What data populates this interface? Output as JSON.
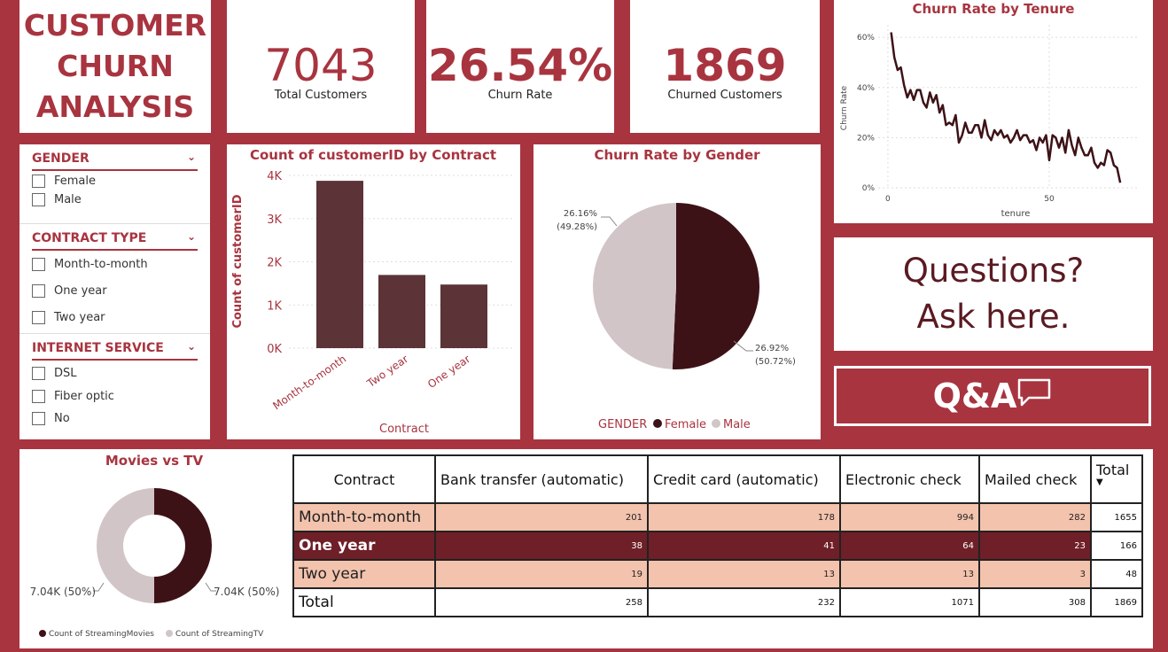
{
  "header": {
    "line1": "CUSTOMER",
    "line2": "CHURN",
    "line3": "ANALYSIS"
  },
  "kpis": [
    {
      "value": "7043",
      "label": "Total Customers"
    },
    {
      "value": "26.54%",
      "label": "Churn Rate"
    },
    {
      "value": "1869",
      "label": "Churned Customers"
    }
  ],
  "slicers": {
    "gender": {
      "title": "GENDER",
      "items": [
        "Female",
        "Male"
      ]
    },
    "contract": {
      "title": "CONTRACT TYPE",
      "items": [
        "Month-to-month",
        "One year",
        "Two year"
      ]
    },
    "internet": {
      "title": "INTERNET SERVICE",
      "items": [
        "DSL",
        "Fiber optic",
        "No"
      ]
    }
  },
  "qa": {
    "line1": "Questions?",
    "line2": "Ask here.",
    "button": "Q&A"
  },
  "colors": {
    "accent": "#a8343f",
    "dark": "#3d1217",
    "bar": "#5c3337",
    "light": "#d2c5c7",
    "peach": "#f3c3ad",
    "darkrow": "#6e1f27"
  },
  "chart_data": [
    {
      "type": "line",
      "title": "Churn Rate by Tenure",
      "xlabel": "tenure",
      "ylabel": "Churn Rate",
      "xticks": [
        "0",
        "50"
      ],
      "yticks": [
        "0%",
        "20%",
        "40%",
        "60%"
      ],
      "ylim": [
        0,
        0.65
      ],
      "xlim": [
        -3,
        78
      ],
      "x": [
        1,
        2,
        3,
        4,
        5,
        6,
        7,
        8,
        9,
        10,
        11,
        12,
        13,
        14,
        15,
        16,
        17,
        18,
        19,
        20,
        21,
        22,
        23,
        24,
        25,
        26,
        27,
        28,
        29,
        30,
        31,
        32,
        33,
        34,
        35,
        36,
        37,
        38,
        39,
        40,
        41,
        42,
        43,
        44,
        45,
        46,
        47,
        48,
        49,
        50,
        51,
        52,
        53,
        54,
        55,
        56,
        57,
        58,
        59,
        60,
        61,
        62,
        63,
        64,
        65,
        66,
        67,
        68,
        69,
        70,
        71,
        72
      ],
      "values": [
        0.62,
        0.52,
        0.47,
        0.48,
        0.41,
        0.36,
        0.39,
        0.35,
        0.39,
        0.39,
        0.34,
        0.32,
        0.38,
        0.34,
        0.37,
        0.3,
        0.33,
        0.25,
        0.26,
        0.25,
        0.29,
        0.18,
        0.21,
        0.26,
        0.22,
        0.22,
        0.25,
        0.25,
        0.2,
        0.27,
        0.21,
        0.19,
        0.23,
        0.21,
        0.23,
        0.2,
        0.21,
        0.18,
        0.2,
        0.23,
        0.19,
        0.21,
        0.21,
        0.18,
        0.19,
        0.15,
        0.2,
        0.18,
        0.21,
        0.11,
        0.21,
        0.2,
        0.16,
        0.2,
        0.14,
        0.23,
        0.17,
        0.13,
        0.2,
        0.16,
        0.13,
        0.13,
        0.16,
        0.1,
        0.08,
        0.1,
        0.09,
        0.15,
        0.14,
        0.09,
        0.08,
        0.02
      ],
      "grid": true
    },
    {
      "type": "bar",
      "title": "Count of customerID by Contract",
      "xlabel": "Contract",
      "ylabel": "Count of customerID",
      "categories": [
        "Month-to-month",
        "Two year",
        "One year"
      ],
      "values": [
        3875,
        1695,
        1473
      ],
      "yticks": [
        "0K",
        "1K",
        "2K",
        "3K",
        "4K"
      ],
      "ylim": [
        0,
        4000
      ]
    },
    {
      "type": "pie",
      "title": "Churn Rate by Gender",
      "legend_title": "GENDER",
      "categories": [
        "Female",
        "Male"
      ],
      "values": [
        26.92,
        26.16
      ],
      "labels": [
        [
          "26.92%",
          "(50.72%)"
        ],
        [
          "26.16%",
          "(49.28%)"
        ]
      ]
    },
    {
      "type": "pie",
      "title": "Movies vs TV",
      "categories": [
        "Count of StreamingMovies",
        "Count of StreamingTV"
      ],
      "values": [
        7043,
        7043
      ],
      "labels": [
        "7.04K (50%)",
        "7.04K (50%)"
      ]
    },
    {
      "type": "table",
      "columns": [
        "Contract",
        "Bank transfer (automatic)",
        "Credit card (automatic)",
        "Electronic check",
        "Mailed check",
        "Total"
      ],
      "rows": [
        {
          "label": "Month-to-month",
          "cells": [
            "201",
            "178",
            "994",
            "282",
            "1655"
          ]
        },
        {
          "label": "One year",
          "cells": [
            "38",
            "41",
            "64",
            "23",
            "166"
          ]
        },
        {
          "label": "Two year",
          "cells": [
            "19",
            "13",
            "13",
            "3",
            "48"
          ]
        },
        {
          "label": "Total",
          "cells": [
            "258",
            "232",
            "1071",
            "308",
            "1869"
          ]
        }
      ]
    }
  ]
}
